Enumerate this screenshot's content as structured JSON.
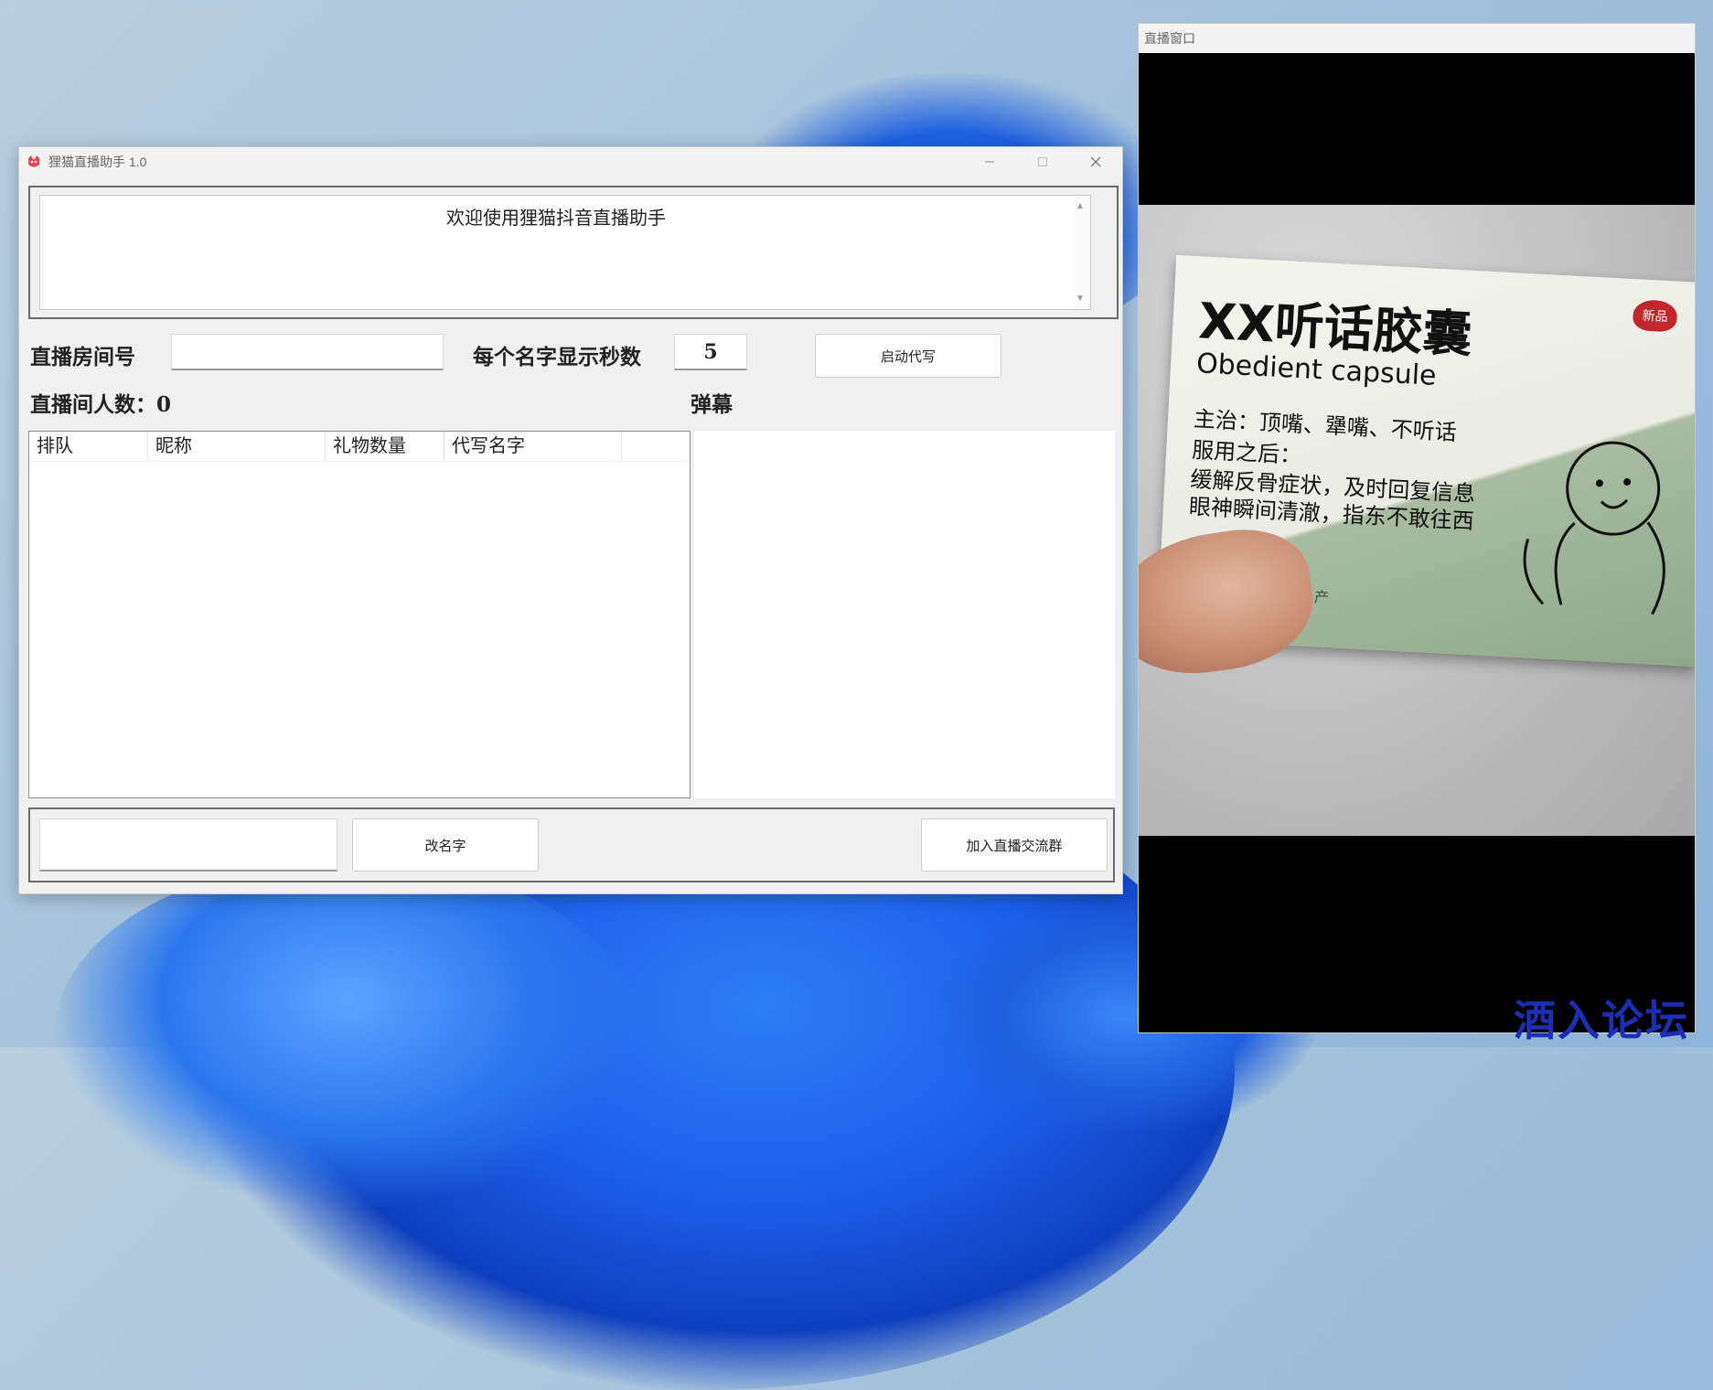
{
  "app": {
    "title": "狸猫直播助手 1.0",
    "welcome_text": "欢迎使用狸猫抖音直播助手",
    "room_label": "直播房间号",
    "room_value": "",
    "seconds_label": "每个名字显示秒数",
    "seconds_value": "5",
    "start_button": "启动代写",
    "viewers_label": "直播间人数：",
    "viewers_count": "0",
    "danmaku_label": "弹幕",
    "table": {
      "columns": [
        "排队",
        "昵称",
        "礼物数量",
        "代写名字"
      ],
      "rows": []
    },
    "rename_input_value": "",
    "rename_button": "改名字",
    "join_group_button": "加入直播交流群"
  },
  "live_window": {
    "title": "直播窗口",
    "video": {
      "product_title": "XX听话胶囊",
      "product_subtitle": "Obedient capsule",
      "line1": "主治：顶嘴、犟嘴、不听话",
      "line2": "服用之后：",
      "line3": "缓解反骨症状，及时回复信息",
      "line4": "眼神瞬间清澈，指东不敢往西",
      "badge": "新品",
      "maker": "药厂生产"
    }
  },
  "watermark": "酒入论坛",
  "colors": {
    "wallpaper_blue": "#1d5fe8",
    "window_bg": "#f0f0f0",
    "badge_red": "#c0262b",
    "watermark_blue": "#1b2fb4"
  }
}
